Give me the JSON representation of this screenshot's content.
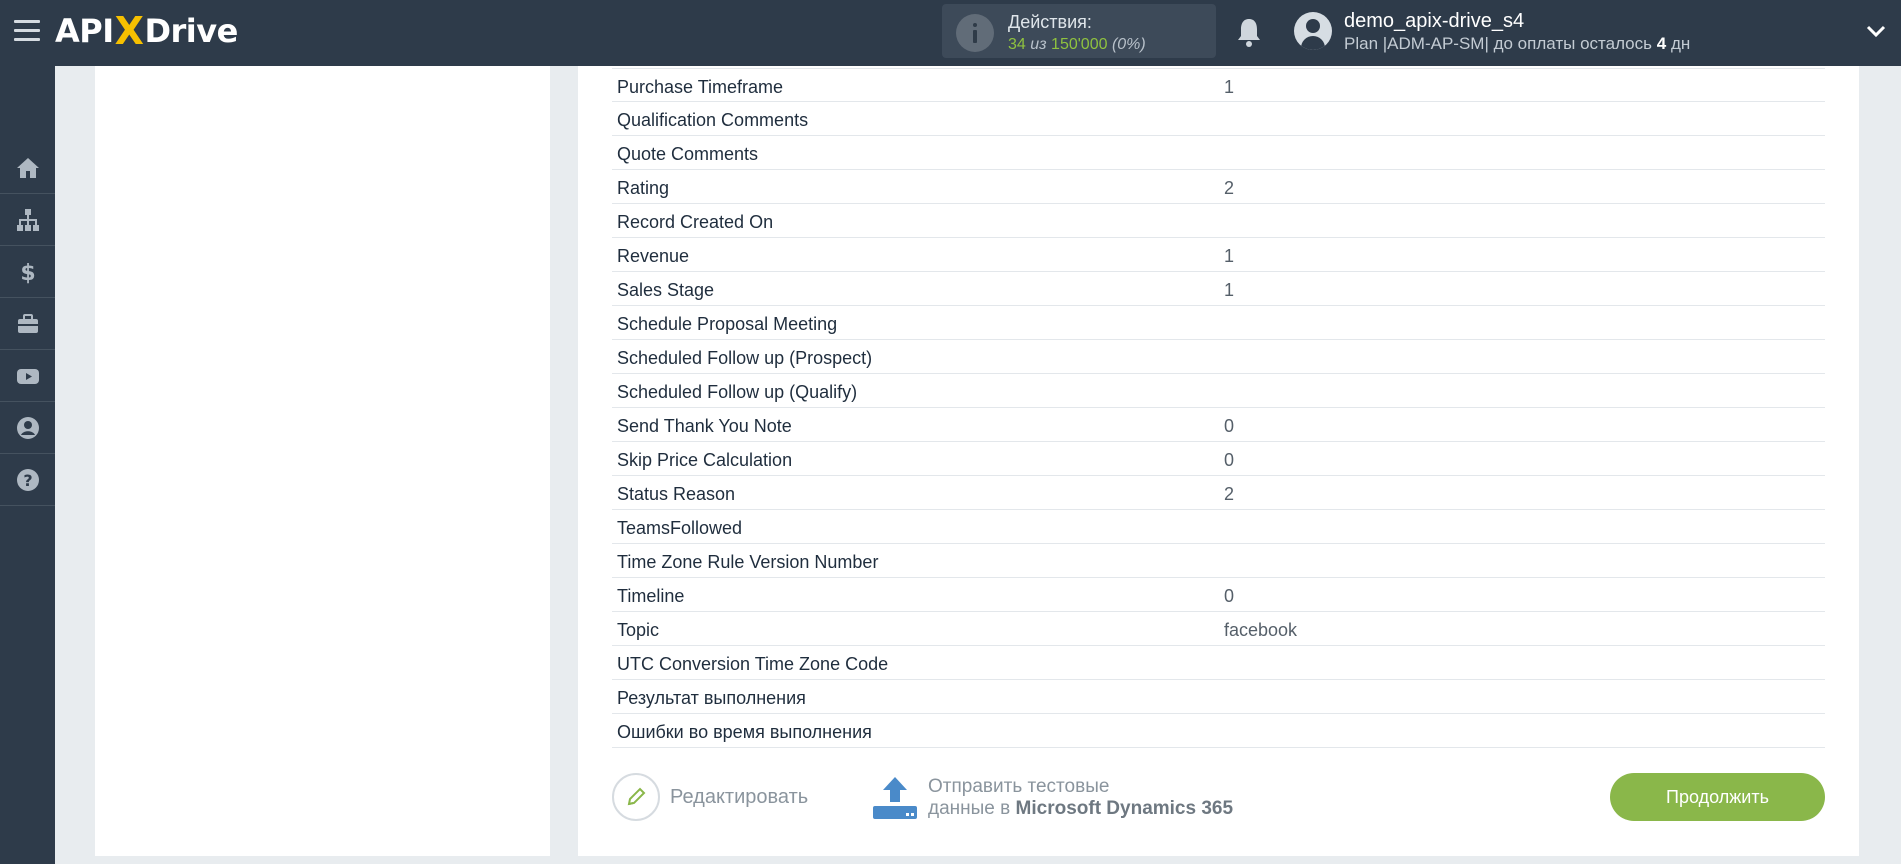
{
  "header": {
    "logo": {
      "prefix": "API",
      "x": "X",
      "suffix": "Drive"
    },
    "actions": {
      "title": "Действия:",
      "used": "34",
      "separator": "из",
      "limit": "150'000",
      "percent": "(0%)"
    },
    "user": {
      "name": "demo_apix-drive_s4",
      "plan_text": "Plan |ADM-AP-SM| до оплаты осталось",
      "days_left": "4",
      "days_unit": "дн"
    }
  },
  "sidebar": {
    "items": [
      {
        "icon": "home-icon"
      },
      {
        "icon": "sitemap-icon"
      },
      {
        "icon": "dollar-icon"
      },
      {
        "icon": "briefcase-icon"
      },
      {
        "icon": "youtube-icon"
      },
      {
        "icon": "user-circle-icon"
      },
      {
        "icon": "question-icon"
      }
    ]
  },
  "fields": [
    {
      "label": "Purchase Timeframe",
      "value": "1"
    },
    {
      "label": "Qualification Comments",
      "value": ""
    },
    {
      "label": "Quote Comments",
      "value": ""
    },
    {
      "label": "Rating",
      "value": "2"
    },
    {
      "label": "Record Created On",
      "value": ""
    },
    {
      "label": "Revenue",
      "value": "1"
    },
    {
      "label": "Sales Stage",
      "value": "1"
    },
    {
      "label": "Schedule Proposal Meeting",
      "value": ""
    },
    {
      "label": "Scheduled Follow up (Prospect)",
      "value": ""
    },
    {
      "label": "Scheduled Follow up (Qualify)",
      "value": ""
    },
    {
      "label": "Send Thank You Note",
      "value": "0"
    },
    {
      "label": "Skip Price Calculation",
      "value": "0"
    },
    {
      "label": "Status Reason",
      "value": "2"
    },
    {
      "label": "TeamsFollowed",
      "value": ""
    },
    {
      "label": "Time Zone Rule Version Number",
      "value": ""
    },
    {
      "label": "Timeline",
      "value": "0"
    },
    {
      "label": "Topic",
      "value": "facebook"
    },
    {
      "label": "UTC Conversion Time Zone Code",
      "value": ""
    },
    {
      "label": "Результат выполнения",
      "value": ""
    },
    {
      "label": "Ошибки во время выполнения",
      "value": ""
    }
  ],
  "footer": {
    "edit_label": "Редактировать",
    "send_line1": "Отправить тестовые",
    "send_line2_prefix": "данные в",
    "send_target": "Microsoft Dynamics 365",
    "continue_label": "Продолжить"
  },
  "colors": {
    "topbar": "#2e3b4a",
    "accent_green": "#8ab74a",
    "logo_x": "#f6c000",
    "upload_blue": "#4a8ac9"
  }
}
